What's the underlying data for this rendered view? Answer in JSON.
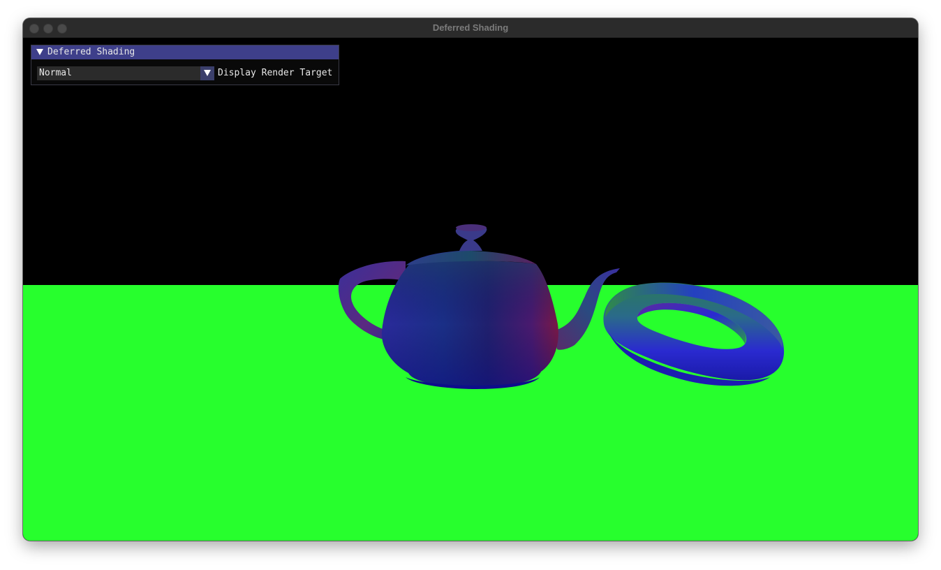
{
  "window": {
    "title": "Deferred Shading"
  },
  "panel": {
    "title": "Deferred Shading",
    "combo_value": "Normal",
    "combo_label": "Display Render Target"
  },
  "scene": {
    "background_color": "#000000",
    "floor_color": "#27ff2d",
    "objects": [
      "teapot",
      "torus"
    ]
  },
  "colors": {
    "titlebar": "#2b2b2b",
    "title_text": "#7b7b7b",
    "panel_header": "#3e3f8a",
    "combo_button": "#3b3f6b"
  }
}
